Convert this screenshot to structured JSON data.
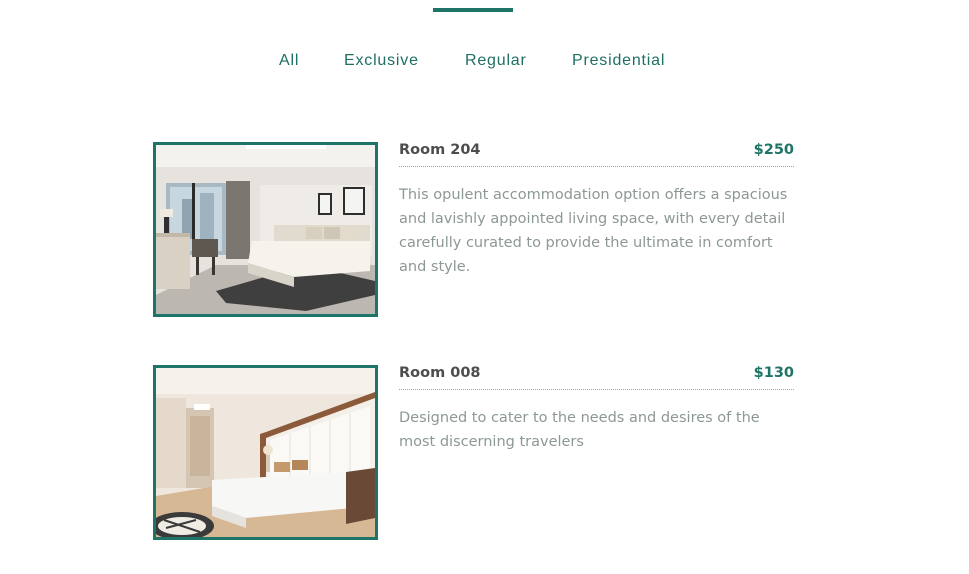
{
  "filters": {
    "tabs": [
      {
        "label": "All"
      },
      {
        "label": "Exclusive"
      },
      {
        "label": "Regular"
      },
      {
        "label": "Presidential"
      }
    ]
  },
  "rooms": [
    {
      "name": "Room 204",
      "price": "$250",
      "description": "This opulent accommodation option offers a spacious and lavishly appointed living space, with every detail carefully curated to provide the ultimate in comfort and style."
    },
    {
      "name": "Room 008",
      "price": "$130",
      "description": "Designed to cater to the needs and desires of the most discerning travelers"
    }
  ],
  "colors": {
    "accent": "#1f7468",
    "heading": "#4d4d4d",
    "body_text": "#8c9896"
  }
}
